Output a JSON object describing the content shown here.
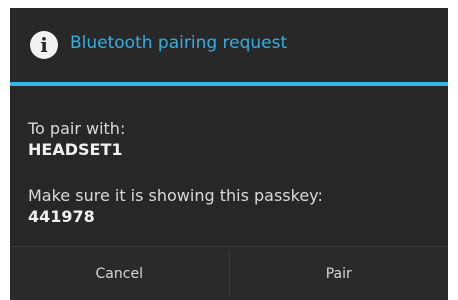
{
  "dialog": {
    "title": "Bluetooth pairing request",
    "icon": "info-icon",
    "accent_color": "#33b5e5"
  },
  "content": {
    "pair_label": "To pair with:",
    "device_name": "HEADSET1",
    "passkey_label": "Make sure it is showing this passkey:",
    "passkey": "441978"
  },
  "buttons": {
    "cancel_label": "Cancel",
    "pair_label": "Pair"
  }
}
